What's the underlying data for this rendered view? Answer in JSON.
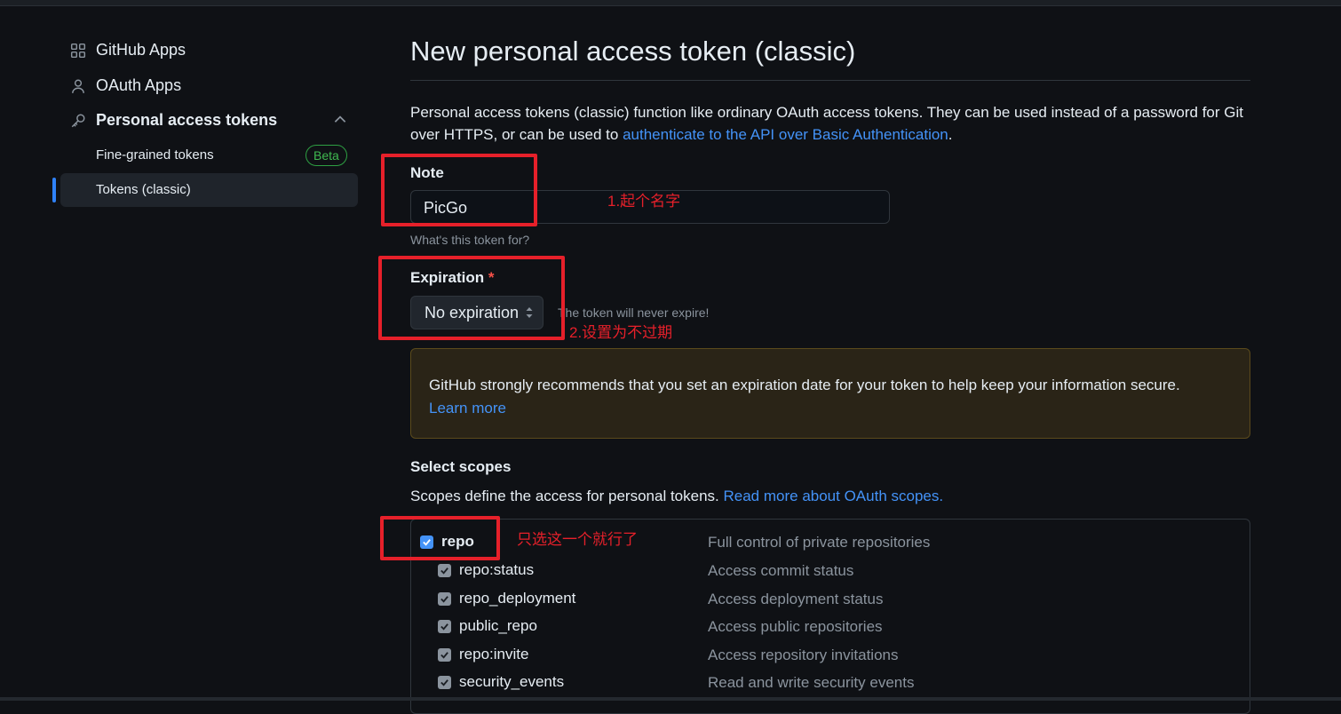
{
  "sidebar": {
    "items": [
      {
        "label": "GitHub Apps",
        "icon": "apps-icon"
      },
      {
        "label": "OAuth Apps",
        "icon": "person-icon"
      },
      {
        "label": "Personal access tokens",
        "icon": "key-icon"
      }
    ],
    "subitems": [
      {
        "label": "Fine-grained tokens",
        "badge": "Beta"
      },
      {
        "label": "Tokens (classic)"
      }
    ]
  },
  "main": {
    "title": "New personal access token (classic)",
    "intro_text": "Personal access tokens (classic) function like ordinary OAuth access tokens. They can be used instead of a password for Git over HTTPS, or can be used to",
    "intro_link": "authenticate to the API over Basic Authentication",
    "intro_end": ".",
    "note_label": "Note",
    "note_value": "PicGo",
    "note_hint": "What's this token for?",
    "expiration_label": "Expiration",
    "required_mark": "*",
    "expiration_value": "No expiration",
    "expiration_note": "The token will never expire!",
    "warning_text": "GitHub strongly recommends that you set an expiration date for your token to help keep your information secure.",
    "warning_link": "Learn more",
    "scopes_heading": "Select scopes",
    "scopes_desc": "Scopes define the access for personal tokens.",
    "scopes_link": "Read more about OAuth scopes.",
    "scopes": [
      {
        "name": "repo",
        "desc": "Full control of private repositories",
        "checked": true
      },
      {
        "name": "repo:status",
        "desc": "Access commit status",
        "checked": true
      },
      {
        "name": "repo_deployment",
        "desc": "Access deployment status",
        "checked": true
      },
      {
        "name": "public_repo",
        "desc": "Access public repositories",
        "checked": true
      },
      {
        "name": "repo:invite",
        "desc": "Access repository invitations",
        "checked": true
      },
      {
        "name": "security_events",
        "desc": "Read and write security events",
        "checked": true
      }
    ]
  },
  "annotations": {
    "note": "1.起个名字",
    "expiration": "2.设置为不过期",
    "repo": "只选这一个就行了"
  },
  "colors": {
    "background": "#0f1115",
    "accent": "#2f81f7",
    "link": "#4493f8",
    "annotation": "#e6202a",
    "badge": "#3fb950",
    "warning_bg": "#2a2417"
  }
}
